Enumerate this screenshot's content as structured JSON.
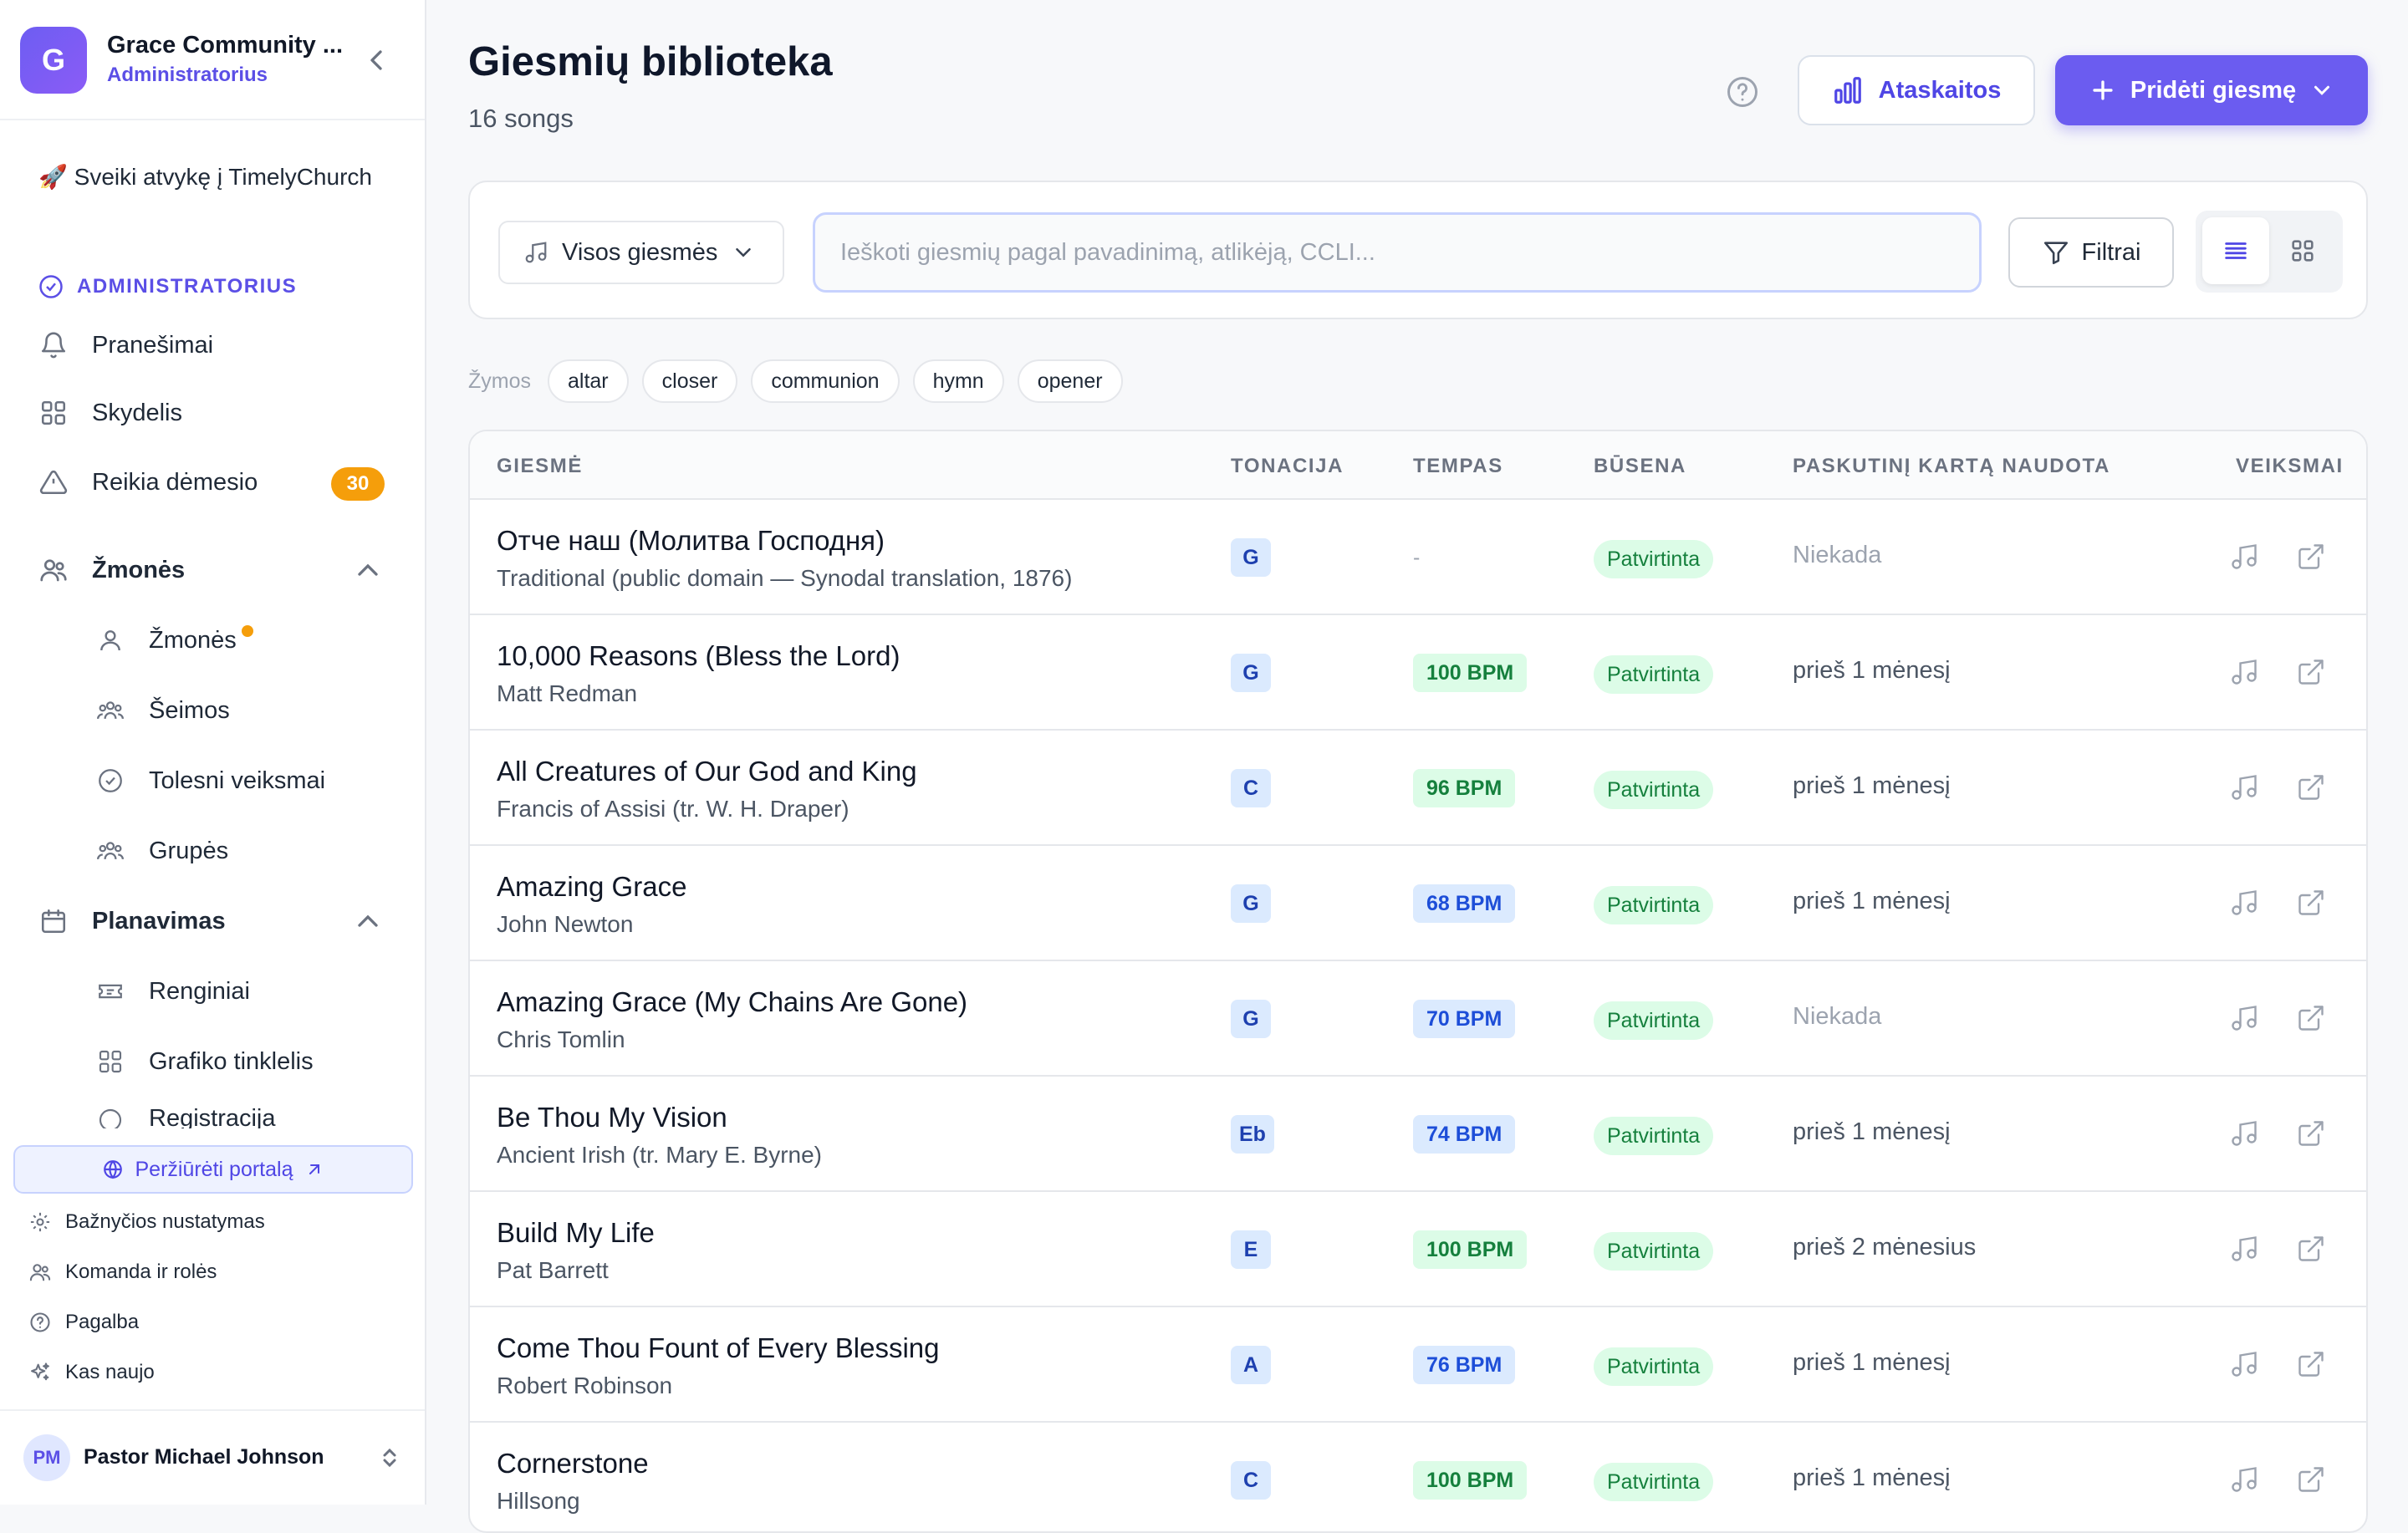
{
  "sidebar": {
    "org_initial": "G",
    "org_name": "Grace Community ...",
    "org_role": "Administratorius",
    "welcome": "🚀 Sveiki atvykę į TimelyChurch",
    "section_admin": "ADMINISTRATORIUS",
    "nav": {
      "notifications": "Pranešimai",
      "dashboard": "Skydelis",
      "attention": "Reikia dėmesio",
      "attention_count": "30",
      "people_group": "Žmonės",
      "people": "Žmonės",
      "families": "Šeimos",
      "followups": "Tolesni veiksmai",
      "groups": "Grupės",
      "planning_group": "Planavimas",
      "events": "Renginiai",
      "schedule_grid": "Grafiko tinklelis",
      "registrations": "Registracija"
    },
    "portal_button": "Peržiūrėti portalą",
    "footer": {
      "church_settings": "Bažnyčios nustatymas",
      "team_roles": "Komanda ir rolės",
      "help": "Pagalba",
      "whats_new": "Kas naujo"
    },
    "user": {
      "initials": "PM",
      "name": "Pastor Michael Johnson"
    }
  },
  "header": {
    "title": "Giesmių biblioteka",
    "count": "16 songs",
    "reports_button": "Ataskaitos",
    "add_button": "Pridėti giesmę"
  },
  "filters": {
    "select_value": "Visos giesmės",
    "search_placeholder": "Ieškoti giesmių pagal pavadinimą, atlikėją, CCLI...",
    "filter_button": "Filtrai"
  },
  "tags": {
    "label": "Žymos",
    "items": [
      "altar",
      "closer",
      "communion",
      "hymn",
      "opener"
    ]
  },
  "table": {
    "columns": {
      "song": "GIESMĖ",
      "key": "TONACIJA",
      "tempo": "TEMPAS",
      "status": "BŪSENA",
      "last_used": "PASKUTINĮ KARTĄ NAUDOTA",
      "actions": "VEIKSMAI"
    },
    "rows": [
      {
        "title": "Отче наш (Молитва Господня)",
        "artist": "Traditional (public domain — Synodal translation, 1876)",
        "key": "G",
        "tempo": "-",
        "status": "Patvirtinta",
        "last_used": "Niekada"
      },
      {
        "title": "10,000 Reasons (Bless the Lord)",
        "artist": "Matt Redman",
        "key": "G",
        "tempo": "100 BPM",
        "status": "Patvirtinta",
        "last_used": "prieš 1 mėnesį"
      },
      {
        "title": "All Creatures of Our God and King",
        "artist": "Francis of Assisi (tr. W. H. Draper)",
        "key": "C",
        "tempo": "96 BPM",
        "status": "Patvirtinta",
        "last_used": "prieš 1 mėnesį"
      },
      {
        "title": "Amazing Grace",
        "artist": "John Newton",
        "key": "G",
        "tempo": "68 BPM",
        "status": "Patvirtinta",
        "last_used": "prieš 1 mėnesį"
      },
      {
        "title": "Amazing Grace (My Chains Are Gone)",
        "artist": "Chris Tomlin",
        "key": "G",
        "tempo": "70 BPM",
        "status": "Patvirtinta",
        "last_used": "Niekada"
      },
      {
        "title": "Be Thou My Vision",
        "artist": "Ancient Irish (tr. Mary E. Byrne)",
        "key": "Eb",
        "tempo": "74 BPM",
        "status": "Patvirtinta",
        "last_used": "prieš 1 mėnesį"
      },
      {
        "title": "Build My Life",
        "artist": "Pat Barrett",
        "key": "E",
        "tempo": "100 BPM",
        "status": "Patvirtinta",
        "last_used": "prieš 2 mėnesius"
      },
      {
        "title": "Come Thou Fount of Every Blessing",
        "artist": "Robert Robinson",
        "key": "A",
        "tempo": "76 BPM",
        "status": "Patvirtinta",
        "last_used": "prieš 1 mėnesį"
      },
      {
        "title": "Cornerstone",
        "artist": "Hillsong",
        "key": "C",
        "tempo": "100 BPM",
        "status": "Patvirtinta",
        "last_used": "prieš 1 mėnesį"
      }
    ]
  },
  "colors": {
    "accent": "#6b5cf0",
    "tempo_fast": "#dcfce7",
    "tempo_slow": "#dbeafe",
    "status_approved": "#dcfce7",
    "badge_attention": "#f59e0b"
  }
}
